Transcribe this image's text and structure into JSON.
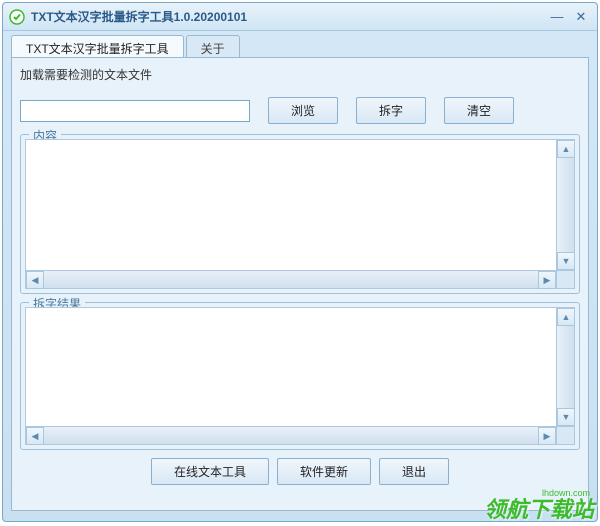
{
  "titlebar": {
    "title": "TXT文本汉字批量拆字工具1.0.20200101"
  },
  "tabs": {
    "main": "TXT文本汉字批量拆字工具",
    "about": "关于"
  },
  "load": {
    "label": "加载需要检测的文本文件",
    "input_value": "",
    "browse": "浏览",
    "split": "拆字",
    "clear": "清空"
  },
  "content_group": {
    "label": "内容",
    "value": ""
  },
  "result_group": {
    "label": "拆字结果",
    "value": ""
  },
  "bottom": {
    "online_tools": "在线文本工具",
    "update": "软件更新",
    "exit": "退出"
  },
  "watermark": {
    "text": "领航下载站",
    "url": "lhdown.com"
  }
}
